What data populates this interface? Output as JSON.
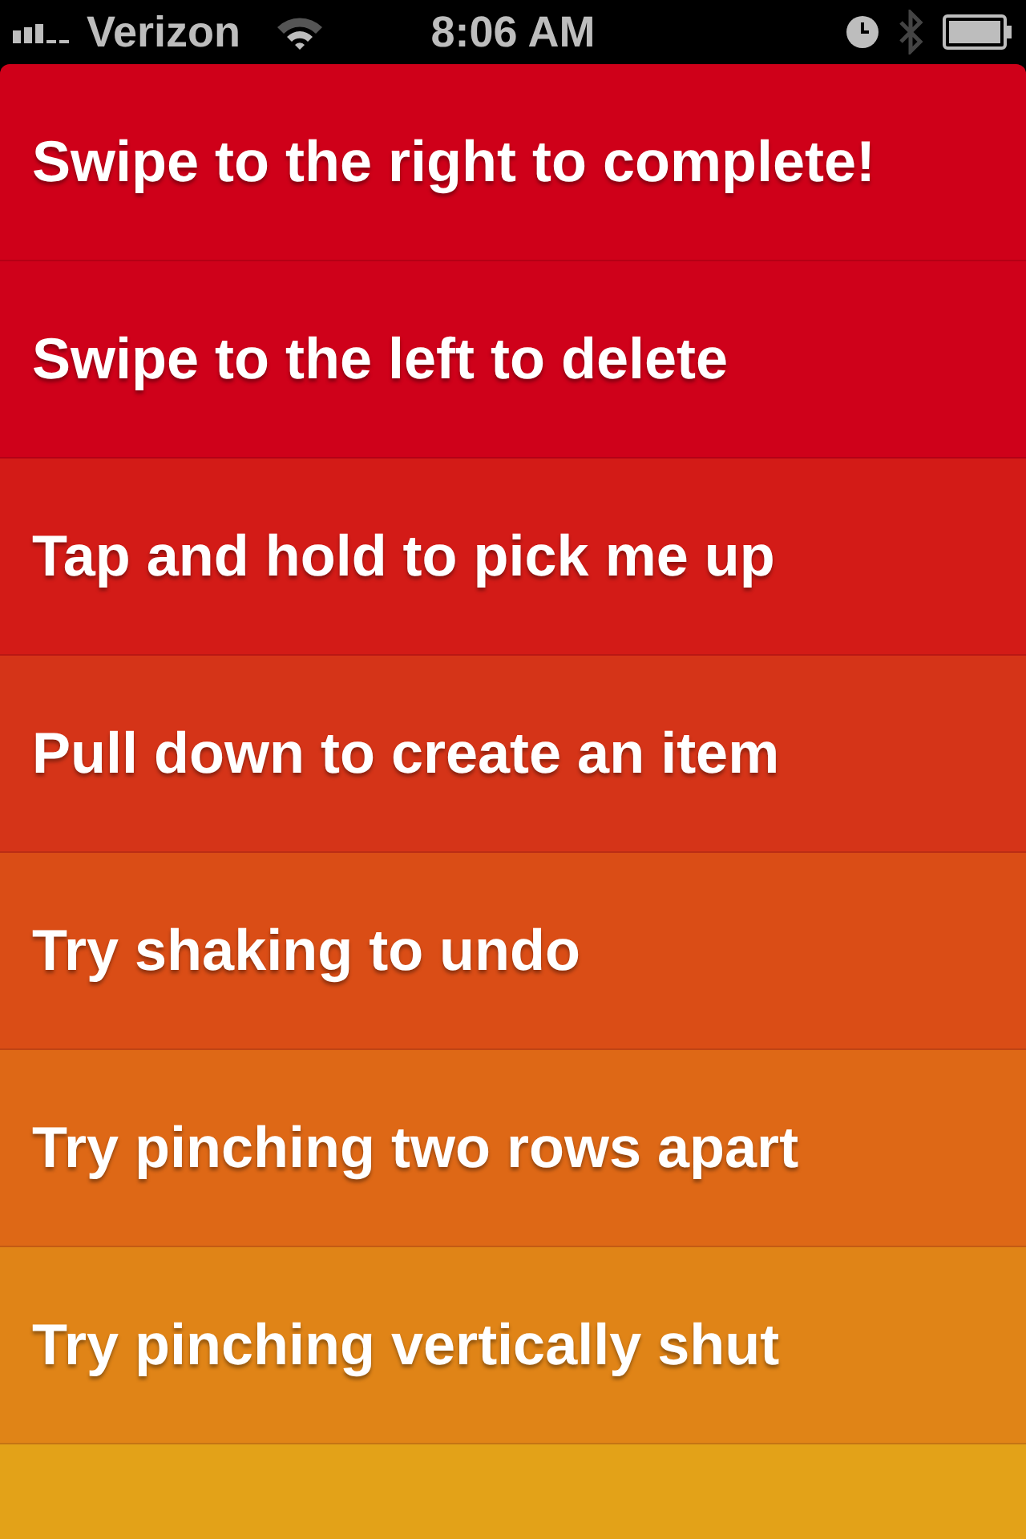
{
  "status_bar": {
    "carrier": "Verizon",
    "time": "8:06 AM"
  },
  "items": [
    {
      "label": "Swipe to the right to complete!",
      "color": "#cf0019"
    },
    {
      "label": "Swipe to the left to delete",
      "color": "#cf011a"
    },
    {
      "label": "Tap and hold to pick me up",
      "color": "#d31b17"
    },
    {
      "label": "Pull down to create an item",
      "color": "#d53418"
    },
    {
      "label": "Try shaking to undo",
      "color": "#da4d16"
    },
    {
      "label": "Try pinching two rows apart",
      "color": "#de6816"
    },
    {
      "label": "Try pinching vertically shut",
      "color": "#e08417"
    },
    {
      "color": "#e3a218"
    }
  ]
}
